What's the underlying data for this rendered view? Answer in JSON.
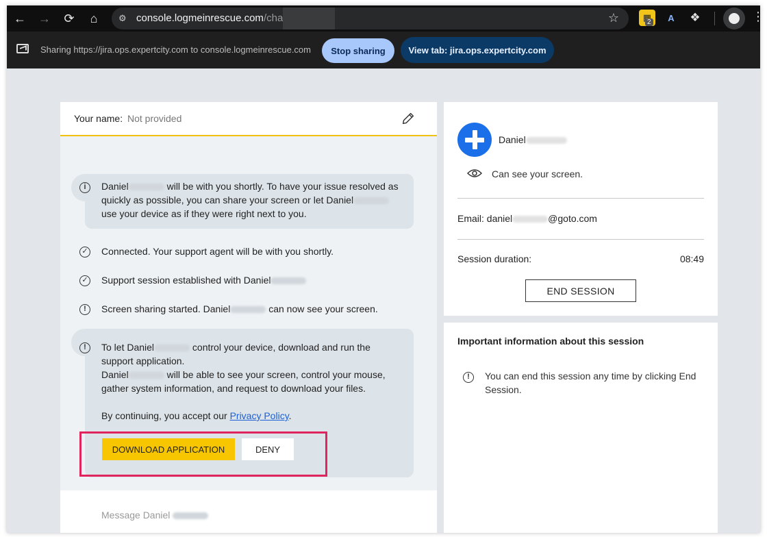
{
  "browser": {
    "url_host": "console.logmeinrescue.com",
    "url_path": "/chat/",
    "extension_badge": "2"
  },
  "sharebar": {
    "text": "Sharing https://jira.ops.expertcity.com to console.logmeinrescue.com",
    "stop_label": "Stop sharing",
    "viewtab_label": "View tab: jira.ops.expertcity.com"
  },
  "chat": {
    "name_label": "Your name:",
    "name_value": "Not provided",
    "messages": [
      {
        "type": "info",
        "parts": [
          "Daniel",
          " will be with you shortly. To have your issue resolved as quickly as possible, you can share your screen or let Daniel",
          " use your device as if they were right next to you."
        ]
      },
      {
        "type": "check",
        "text": "Connected. Your support agent will be with you shortly."
      },
      {
        "type": "check",
        "text": "Support session established with Daniel"
      },
      {
        "type": "alert",
        "parts": [
          "Screen sharing started. Daniel",
          " can now see your screen."
        ]
      }
    ],
    "download_prompt": {
      "line1a": "To let Daniel",
      "line1b": " control your device, download and run the support application.",
      "line2a": "Daniel",
      "line2b": " will be able to see your screen, control your mouse, gather system information, and request to download your files.",
      "consent_prefix": "By continuing, you accept our ",
      "privacy_link": "Privacy Policy",
      "consent_suffix": "."
    },
    "download_button": "DOWNLOAD APPLICATION",
    "deny_button": "DENY",
    "input_placeholder": "Message Daniel"
  },
  "agent": {
    "name": "Daniel",
    "status": "Can see your screen.",
    "email_prefix": "Email: daniel",
    "email_suffix": "@goto.com",
    "duration_label": "Session duration:",
    "duration_value": "08:49",
    "end_button": "END SESSION"
  },
  "info": {
    "title": "Important information about this session",
    "text": "You can end this session any time by clicking End Session."
  },
  "colors": {
    "accent_yellow": "#f7c600",
    "highlight_border": "#e0245e",
    "avatar_blue": "#1b6fe8",
    "link": "#1a5fd6"
  }
}
